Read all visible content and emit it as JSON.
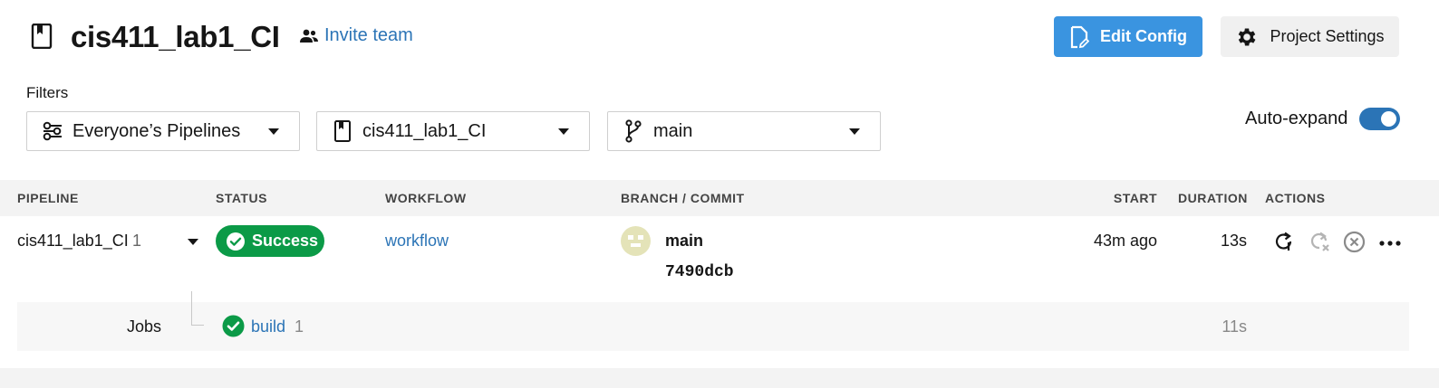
{
  "header": {
    "project_title": "cis411_lab1_CI",
    "invite_label": "Invite team",
    "edit_config_label": "Edit Config",
    "project_settings_label": "Project Settings"
  },
  "filters": {
    "label": "Filters",
    "pipelines_dropdown": "Everyone’s Pipelines",
    "project_dropdown": "cis411_lab1_CI",
    "branch_dropdown": "main",
    "auto_expand_label": "Auto-expand",
    "auto_expand_on": true
  },
  "table": {
    "columns": [
      "PIPELINE",
      "STATUS",
      "WORKFLOW",
      "BRANCH / COMMIT",
      "START",
      "DURATION",
      "ACTIONS"
    ],
    "row": {
      "pipeline_name": "cis411_lab1_CI",
      "pipeline_number": "1",
      "status": "Success",
      "workflow": "workflow",
      "branch": "main",
      "commit": "7490dcb",
      "start": "43m ago",
      "duration": "13s"
    },
    "jobs": {
      "label": "Jobs",
      "job_name": "build",
      "job_number": "1",
      "job_duration": "11s"
    }
  },
  "colors": {
    "primary": "#3a94e0",
    "link": "#2b74b6",
    "success": "#0b9a47"
  }
}
